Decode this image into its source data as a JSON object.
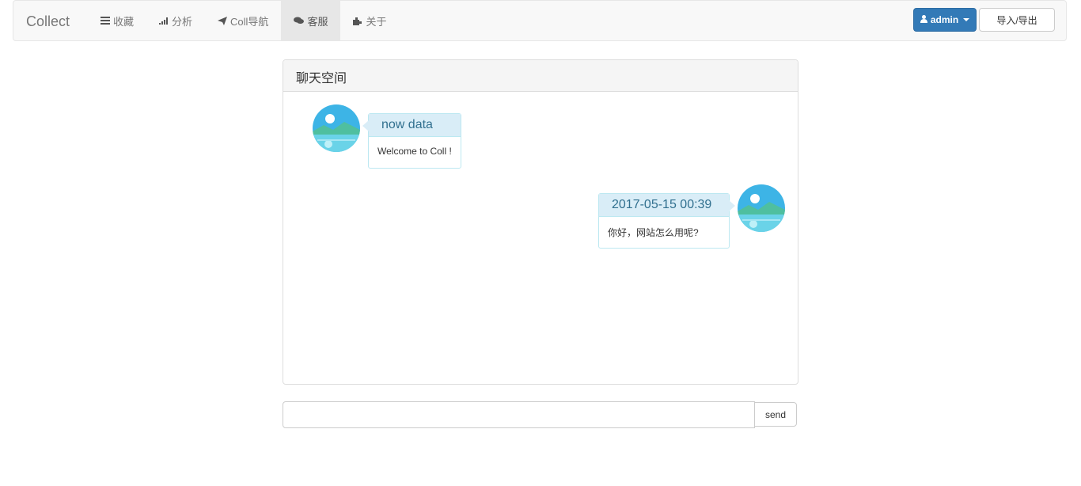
{
  "navbar": {
    "brand": "Collect",
    "items": [
      {
        "label": "收藏",
        "icon": "list-icon"
      },
      {
        "label": "分析",
        "icon": "signal-icon"
      },
      {
        "label": "Coll导航",
        "icon": "send-icon"
      },
      {
        "label": "客服",
        "icon": "comment-icon",
        "active": true
      },
      {
        "label": "关于",
        "icon": "puzzle-icon"
      }
    ],
    "user_button": "admin",
    "import_export_button": "导入/导出"
  },
  "chat_panel": {
    "title": "聊天空间",
    "messages": [
      {
        "side": "left",
        "header": "now data",
        "text": "Welcome to Coll !"
      },
      {
        "side": "right",
        "header": "2017-05-15 00:39",
        "text": "你好，网站怎么用呢?"
      }
    ]
  },
  "composer": {
    "value": "",
    "placeholder": "",
    "send_label": "send"
  },
  "colors": {
    "primary": "#337ab7",
    "bubble_head_bg": "#d9edf7",
    "bubble_head_text": "#31708f",
    "navbar_bg": "#f8f8f8",
    "active_tab_bg": "#e7e7e7"
  }
}
